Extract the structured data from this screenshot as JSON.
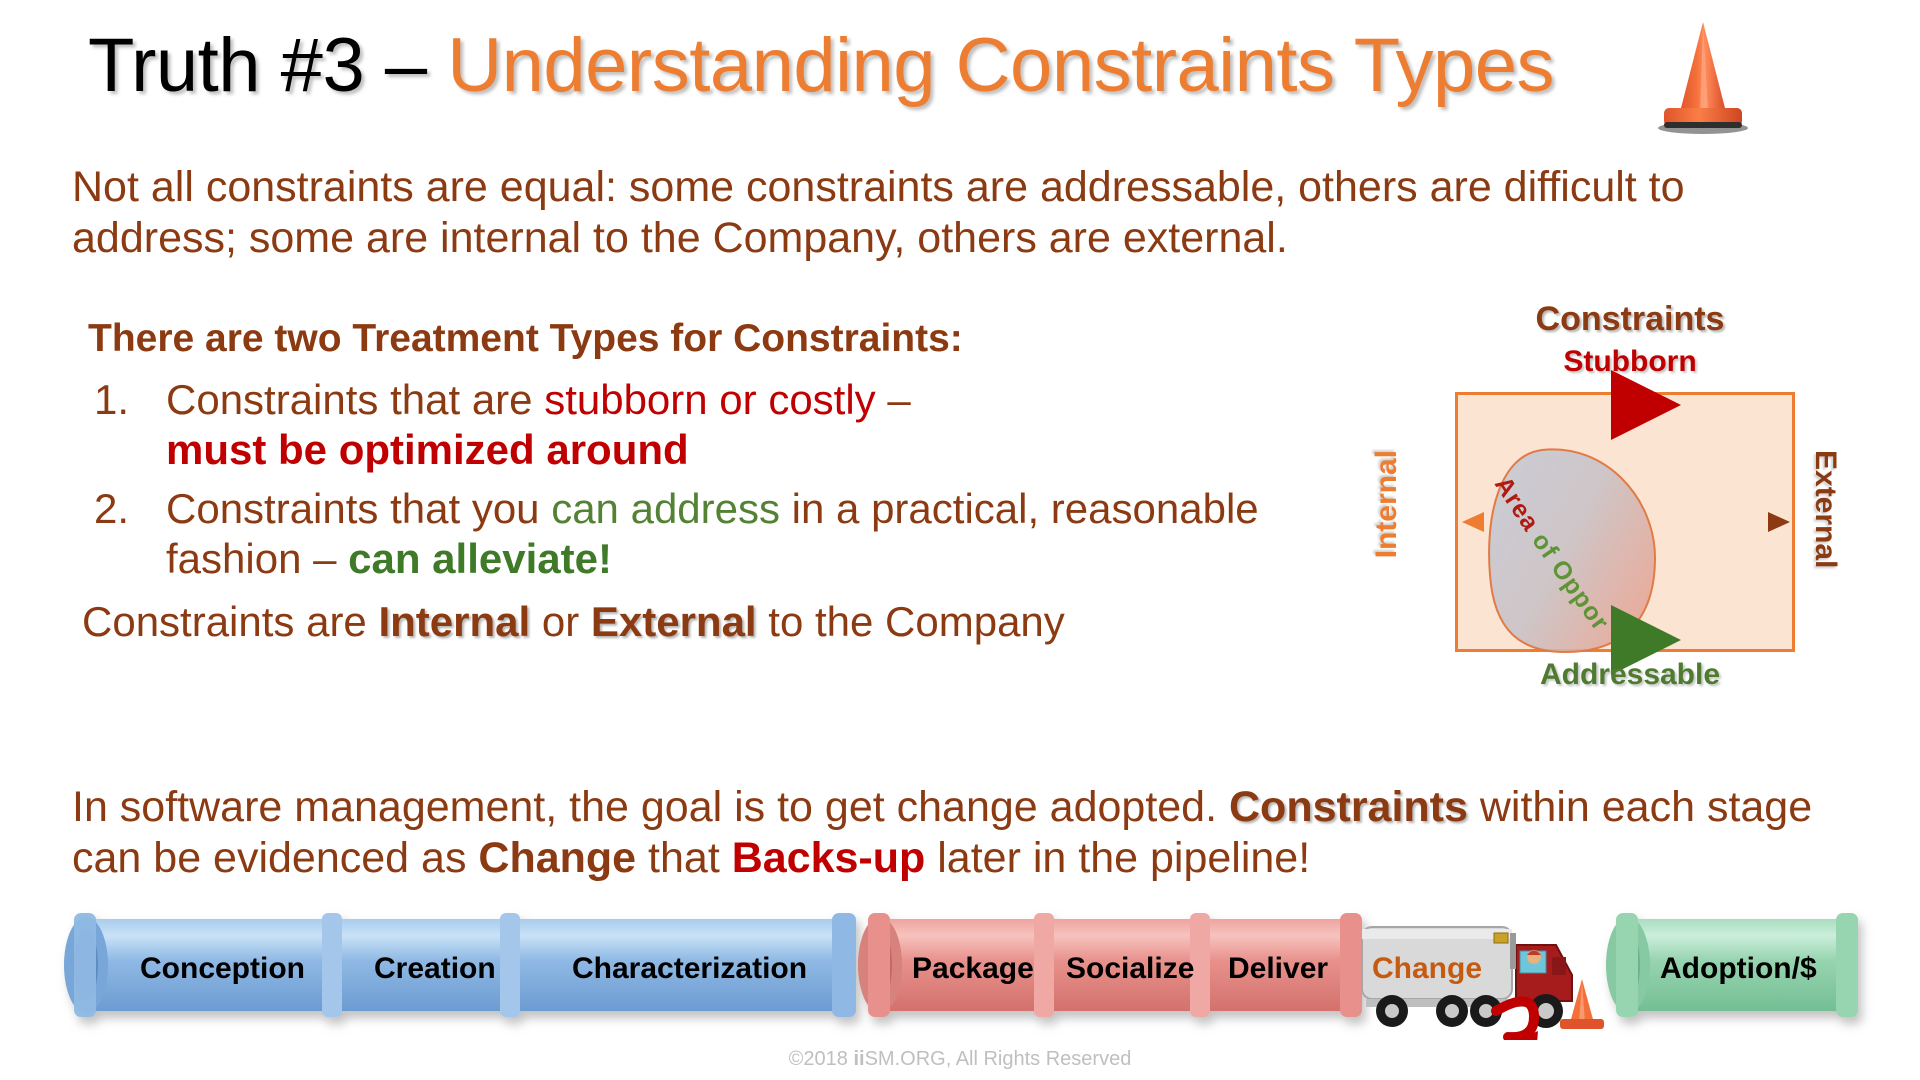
{
  "slide": {
    "title": {
      "prefix": "Truth #3 – ",
      "highlight": "Understanding Constraints Types"
    },
    "cone_icon": "traffic-cone-icon",
    "lead_paragraph": "Not all constraints are equal: some constraints are addressable, others are difficult to address; some are internal to the Company, others are external.",
    "left_column": {
      "heading": "There are two Treatment Types for Constraints:",
      "items": [
        {
          "number": "1.",
          "part1": "Constraints that are ",
          "emphasis1": "stubborn or costly",
          "part2": " – ",
          "emphasis2": "must be optimized around"
        },
        {
          "number": "2.",
          "part1": "Constraints that you ",
          "emphasis1": "can address",
          "part2": " in a practical, reasonable fashion – ",
          "emphasis2": "can alleviate!"
        }
      ],
      "internal_external_line": {
        "prefix": "Constraints are ",
        "word1": "Internal",
        "middle": " or ",
        "word2": "External",
        "suffix": " to the Company"
      }
    },
    "quadrant": {
      "title": "Constraints",
      "top_label": "Stubborn",
      "bottom_label": "Addressable",
      "left_label": "Internal",
      "right_label": "External",
      "blob_label_red": "Area",
      "blob_label_green": "of Opportunity",
      "blob_label_full": "Area of Opportunity"
    },
    "bottom_paragraph": {
      "part1": "In software management, the goal is to get change adopted. ",
      "bold1": "Constraints",
      "part2": " within each stage can be evidenced as ",
      "bold2": "Change",
      "part3": " that ",
      "bold3": "Backs-up",
      "part4": " later in the pipeline!"
    },
    "pipeline": {
      "blue_stages": [
        "Conception",
        "Creation",
        "Characterization"
      ],
      "pink_stages": [
        "Package",
        "Socialize",
        "Deliver"
      ],
      "truck_label": "Change",
      "green_stage": "Adoption/$",
      "cone_icon": "traffic-cone-icon",
      "backup_arrow_icon": "u-turn-arrow-icon"
    },
    "footer": {
      "prefix": "©2018 ",
      "bold": "ii",
      "suffix": "SM.ORG, All Rights Reserved"
    },
    "colors": {
      "brown": "#8B3A12",
      "orange": "#ED7D31",
      "red": "#C00000",
      "green": "#4E7B30",
      "black": "#000000",
      "blue_pipe": "#8DB4E2",
      "pink_pipe": "#E8918C",
      "green_pipe": "#9BD7B4",
      "box_fill": "#FCE4D3",
      "footer_grey": "#BFBFBF"
    }
  }
}
